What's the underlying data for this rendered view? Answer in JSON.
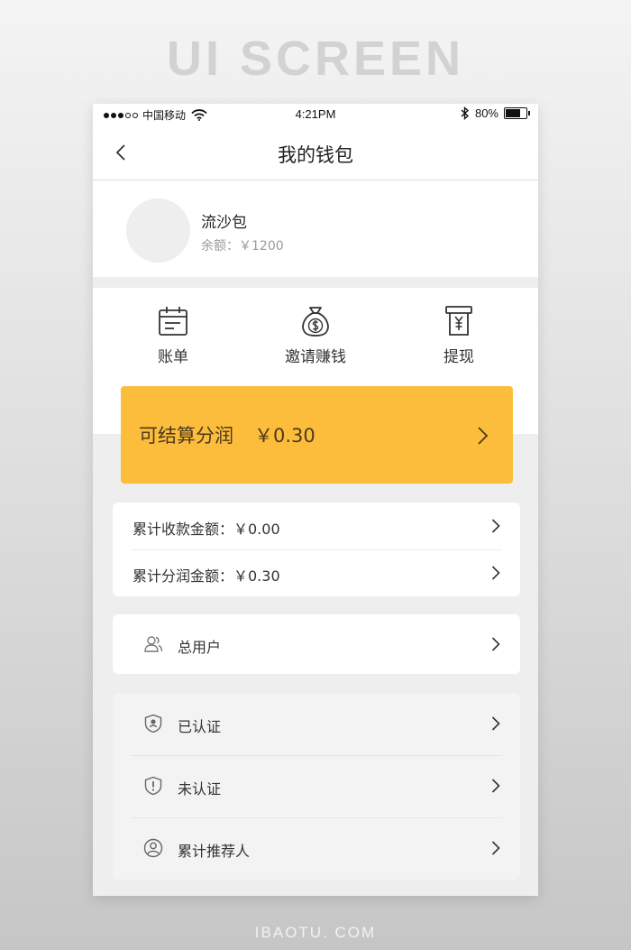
{
  "banner": {
    "title": "UI SCREEN"
  },
  "status_bar": {
    "carrier": "中国移动",
    "time": "4:21PM",
    "battery_text": "80%",
    "battery_level": 0.8
  },
  "nav": {
    "title": "我的钱包",
    "back_icon": "chevron-left-icon"
  },
  "profile": {
    "name": "流沙包",
    "balance": "余额：￥1200"
  },
  "actions": [
    {
      "label": "账单",
      "icon": "calendar-icon"
    },
    {
      "label": "邀请赚钱",
      "icon": "money-bag-icon"
    },
    {
      "label": "提现",
      "icon": "atm-withdraw-icon"
    }
  ],
  "profit_card": {
    "label": "可结算分润",
    "value": "￥0.30",
    "accent": "#fcbd3d"
  },
  "stats": [
    {
      "label": "累计收款金额：￥0.00"
    },
    {
      "label": "累计分润金额：￥0.30"
    }
  ],
  "users": {
    "label": "总用户",
    "icon": "users-icon"
  },
  "auth_list": [
    {
      "label": "已认证",
      "icon": "shield-check-icon"
    },
    {
      "label": "未认证",
      "icon": "shield-exclamation-icon"
    },
    {
      "label": "累计推荐人",
      "icon": "user-circle-icon"
    }
  ],
  "footer": {
    "text": "IBAOTU. COM"
  }
}
